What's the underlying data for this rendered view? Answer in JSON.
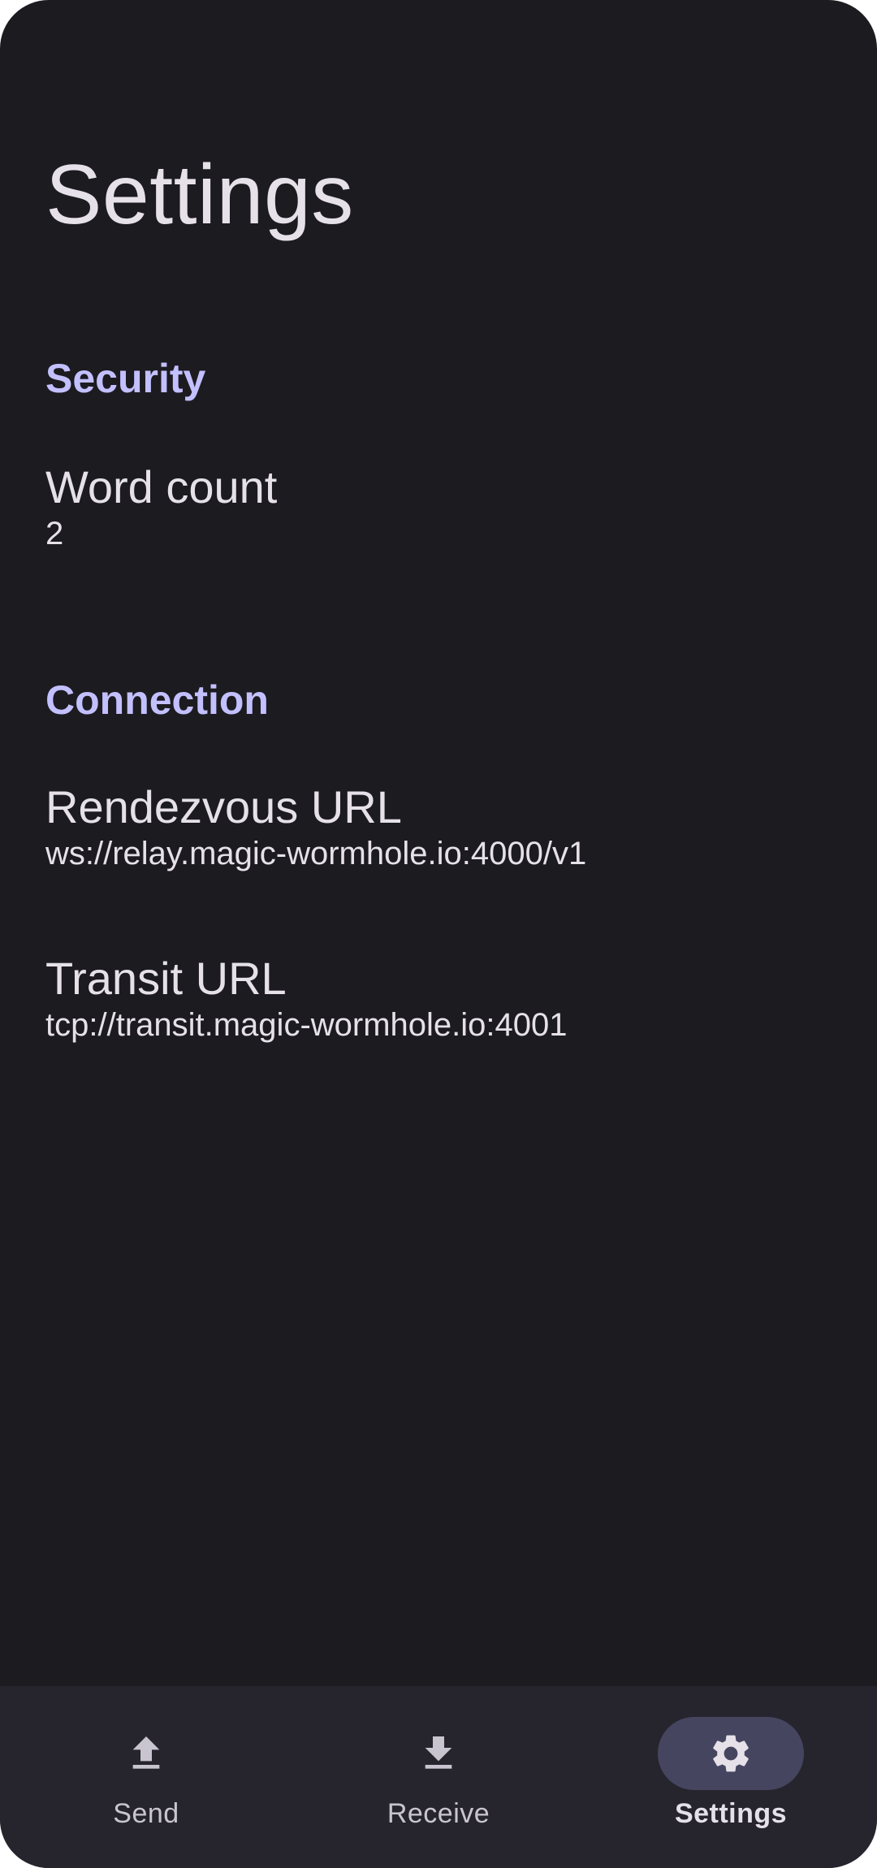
{
  "page": {
    "title": "Settings"
  },
  "sections": {
    "security": {
      "header": "Security",
      "word_count": {
        "title": "Word count",
        "value": "2"
      }
    },
    "connection": {
      "header": "Connection",
      "rendezvous_url": {
        "title": "Rendezvous URL",
        "value": "ws://relay.magic-wormhole.io:4000/v1"
      },
      "transit_url": {
        "title": "Transit URL",
        "value": "tcp://transit.magic-wormhole.io:4001"
      }
    }
  },
  "nav": {
    "items": [
      {
        "label": "Send",
        "icon": "upload-icon",
        "active": false
      },
      {
        "label": "Receive",
        "icon": "download-icon",
        "active": false
      },
      {
        "label": "Settings",
        "icon": "gear-icon",
        "active": true
      }
    ]
  },
  "colors": {
    "background": "#1c1b20",
    "nav_background": "#26252e",
    "accent": "#c3c0ff",
    "active_indicator": "#464560",
    "text": "#e6e1e9"
  }
}
